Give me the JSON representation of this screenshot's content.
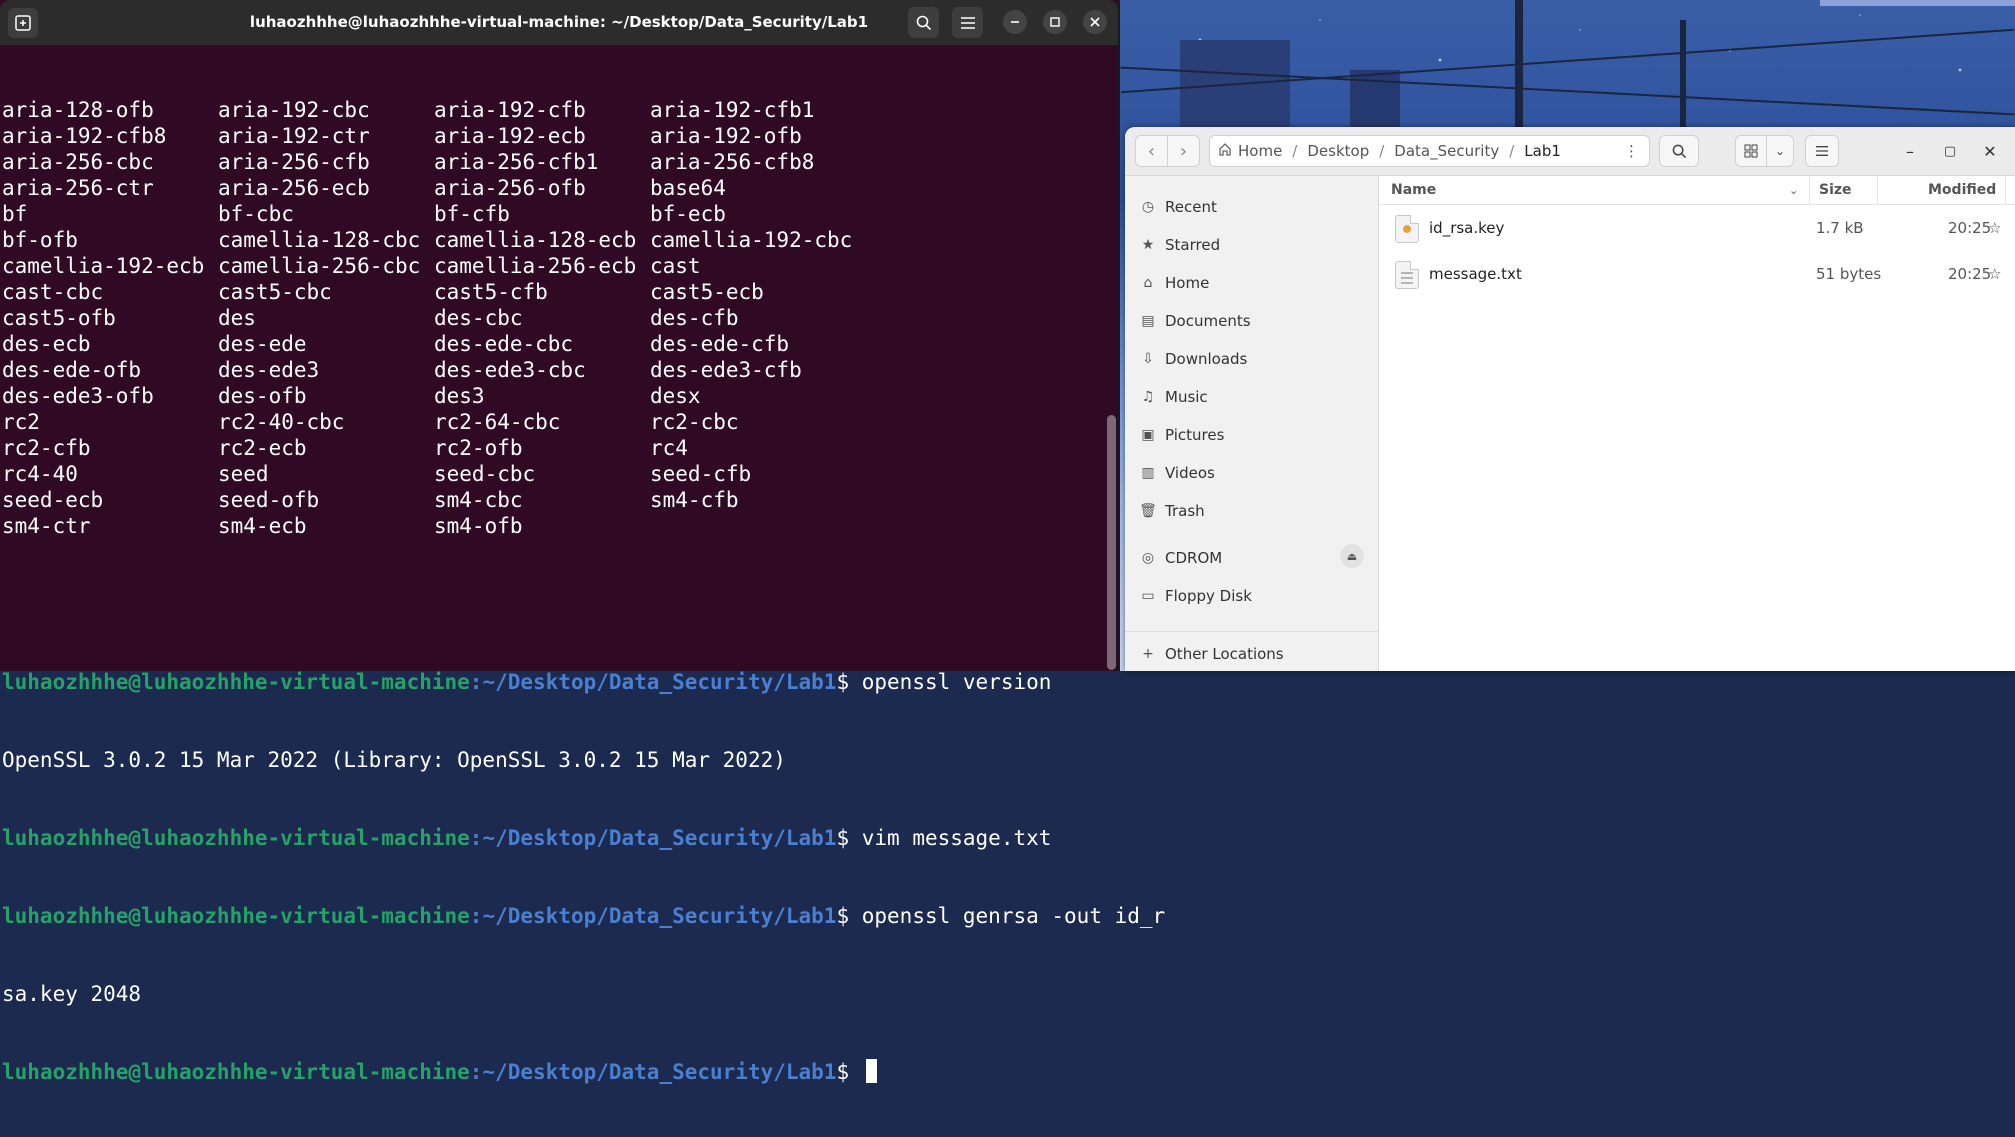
{
  "terminal": {
    "title": "luhaozhhhe@luhaozhhhe-virtual-machine: ~/Desktop/Data_Security/Lab1",
    "cipher_rows": [
      [
        "aria-128-ofb",
        "aria-192-cbc",
        "aria-192-cfb",
        "aria-192-cfb1"
      ],
      [
        "aria-192-cfb8",
        "aria-192-ctr",
        "aria-192-ecb",
        "aria-192-ofb"
      ],
      [
        "aria-256-cbc",
        "aria-256-cfb",
        "aria-256-cfb1",
        "aria-256-cfb8"
      ],
      [
        "aria-256-ctr",
        "aria-256-ecb",
        "aria-256-ofb",
        "base64"
      ],
      [
        "bf",
        "bf-cbc",
        "bf-cfb",
        "bf-ecb"
      ],
      [
        "bf-ofb",
        "camellia-128-cbc",
        "camellia-128-ecb",
        "camellia-192-cbc"
      ],
      [
        "camellia-192-ecb",
        "camellia-256-cbc",
        "camellia-256-ecb",
        "cast"
      ],
      [
        "cast-cbc",
        "cast5-cbc",
        "cast5-cfb",
        "cast5-ecb"
      ],
      [
        "cast5-ofb",
        "des",
        "des-cbc",
        "des-cfb"
      ],
      [
        "des-ecb",
        "des-ede",
        "des-ede-cbc",
        "des-ede-cfb"
      ],
      [
        "des-ede-ofb",
        "des-ede3",
        "des-ede3-cbc",
        "des-ede3-cfb"
      ],
      [
        "des-ede3-ofb",
        "des-ofb",
        "des3",
        "desx"
      ],
      [
        "rc2",
        "rc2-40-cbc",
        "rc2-64-cbc",
        "rc2-cbc"
      ],
      [
        "rc2-cfb",
        "rc2-ecb",
        "rc2-ofb",
        "rc4"
      ],
      [
        "rc4-40",
        "seed",
        "seed-cbc",
        "seed-cfb"
      ],
      [
        "seed-ecb",
        "seed-ofb",
        "sm4-cbc",
        "sm4-cfb"
      ],
      [
        "sm4-ctr",
        "sm4-ecb",
        "sm4-ofb",
        ""
      ]
    ],
    "prompt_user": "luhaozhhhe@luhaozhhhe-virtual-machine",
    "prompt_path": ":~/Desktop/Data_Security/Lab1",
    "prompt_sym": "$ ",
    "cmd1": "openssl version",
    "out1": "OpenSSL 3.0.2 15 Mar 2022 (Library: OpenSSL 3.0.2 15 Mar 2022)",
    "cmd2": "vim message.txt",
    "cmd3": "openssl genrsa -out id_r",
    "cmd3_wrap": "sa.key 2048"
  },
  "files": {
    "path": [
      "Home",
      "Desktop",
      "Data_Security",
      "Lab1"
    ],
    "sidebar": [
      "Recent",
      "Starred",
      "Home",
      "Documents",
      "Downloads",
      "Music",
      "Pictures",
      "Videos",
      "Trash",
      "CDROM",
      "Floppy Disk",
      "Other Locations"
    ],
    "columns": {
      "name": "Name",
      "size": "Size",
      "modified": "Modified"
    },
    "rows": [
      {
        "name": "id_rsa.key",
        "size": "1.7 kB",
        "modified": "20:25"
      },
      {
        "name": "message.txt",
        "size": "51 bytes",
        "modified": "20:25"
      }
    ]
  },
  "colors": {
    "terminal_bg": "#300a24",
    "prompt_user": "#26a269",
    "prompt_path": "#4a7fd1"
  }
}
